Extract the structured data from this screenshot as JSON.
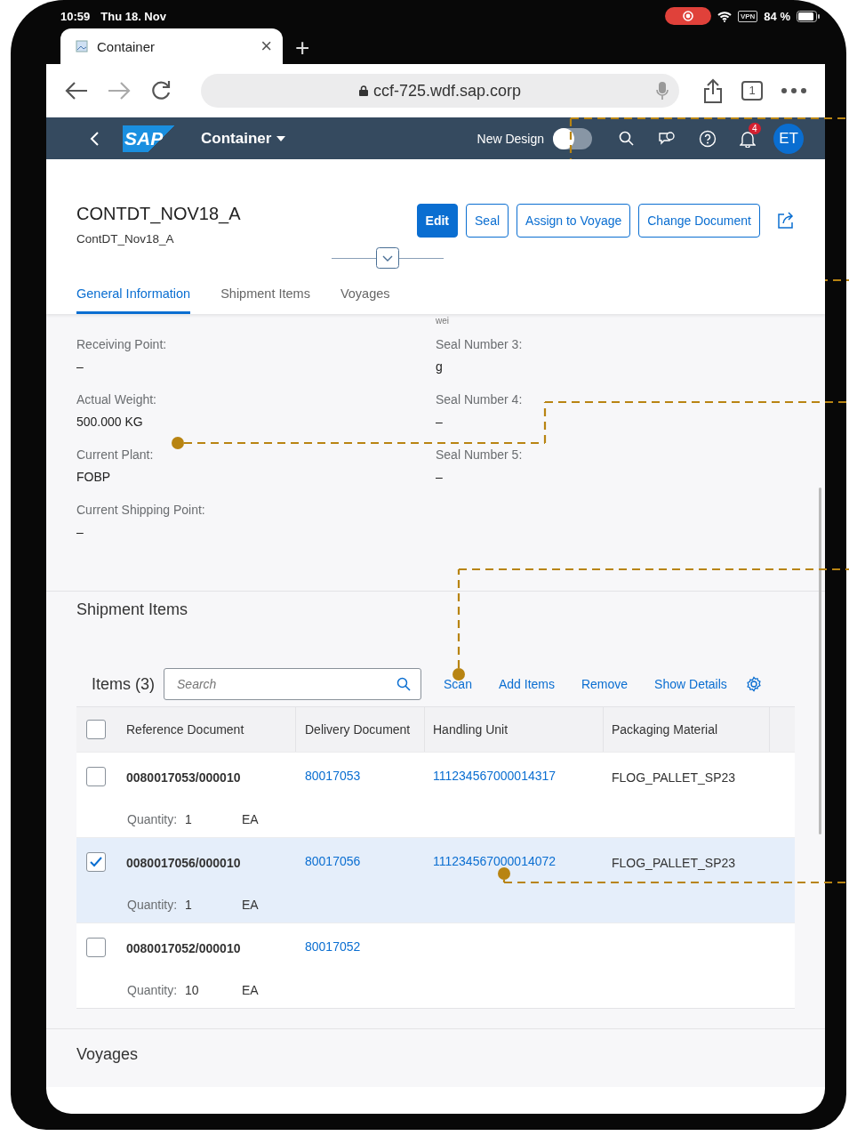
{
  "status_bar": {
    "time": "10:59",
    "date": "Thu 18. Nov",
    "vpn": "VPN",
    "battery": "84 %"
  },
  "browser": {
    "tab_title": "Container",
    "close": "×",
    "new_tab": "+",
    "url": "ccf-725.wdf.sap.corp",
    "tab_count": "1"
  },
  "shell_bar": {
    "logo_text": "SAP",
    "title": "Container",
    "new_design_label": "New Design",
    "new_design_on": false,
    "notification_count": "4",
    "avatar": "ET"
  },
  "header": {
    "title": "CONTDT_NOV18_A",
    "subtitle": "ContDT_Nov18_A",
    "actions": [
      {
        "label": "Edit",
        "emphasized": true
      },
      {
        "label": "Seal",
        "emphasized": false
      },
      {
        "label": "Assign to Voyage",
        "emphasized": false
      },
      {
        "label": "Change Document",
        "emphasized": false
      }
    ]
  },
  "tabs": [
    {
      "label": "General Information",
      "selected": true
    },
    {
      "label": "Shipment Items",
      "selected": false
    },
    {
      "label": "Voyages",
      "selected": false
    }
  ],
  "general": {
    "cut_text": "wei",
    "left_fields": [
      {
        "label": "Receiving Point:",
        "value": "–"
      },
      {
        "label": "Actual Weight:",
        "value": "500.000  KG"
      },
      {
        "label": "Current Plant:",
        "value": "FOBP"
      },
      {
        "label": "Current Shipping Point:",
        "value": "–"
      }
    ],
    "right_fields": [
      {
        "label": "Seal Number 3:",
        "value": "g"
      },
      {
        "label": "Seal Number 4:",
        "value": "–"
      },
      {
        "label": "Seal Number 5:",
        "value": "–"
      }
    ]
  },
  "shipment_items": {
    "title": "Shipment Items",
    "table_title": "Items (3)",
    "search": {
      "placeholder": "Search"
    },
    "actions": [
      "Scan",
      "Add Items",
      "Remove",
      "Show Details"
    ],
    "select_all_checked": false,
    "columns": [
      "Reference Document",
      "Delivery Document",
      "Handling Unit",
      "Packaging Material"
    ],
    "rows": [
      {
        "reference": "0080017053/000010",
        "delivery": "80017053",
        "handling_unit": "111234567000014317",
        "packaging": "FLOG_PALLET_SP23",
        "quantity_label": "Quantity:",
        "quantity": "1",
        "unit": "EA",
        "selected": false
      },
      {
        "reference": "0080017056/000010",
        "delivery": "80017056",
        "handling_unit": "111234567000014072",
        "packaging": "FLOG_PALLET_SP23",
        "quantity_label": "Quantity:",
        "quantity": "1",
        "unit": "EA",
        "selected": true
      },
      {
        "reference": "0080017052/000010",
        "delivery": "80017052",
        "quantity_label": "Quantity:",
        "quantity": "10",
        "unit": "EA",
        "selected": false
      }
    ]
  },
  "voyages": {
    "title": "Voyages"
  }
}
